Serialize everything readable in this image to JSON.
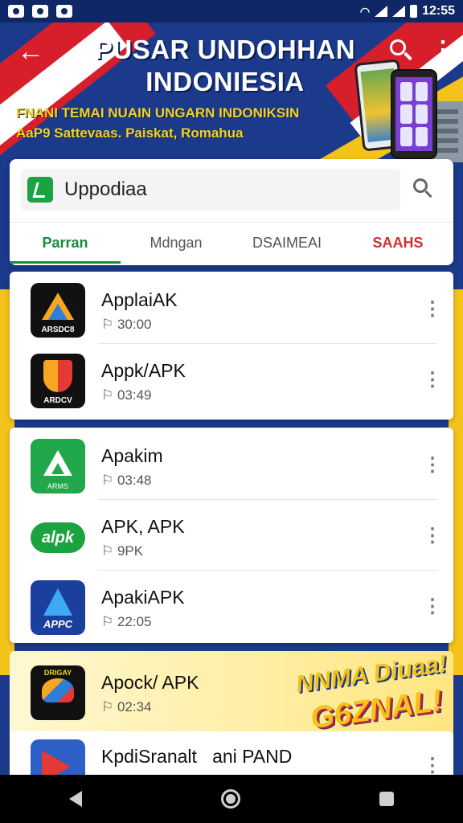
{
  "status_bar": {
    "time": "12:55"
  },
  "header": {
    "title": "PUSAR UNDOHHAN INDONIESIA",
    "subtitle_line1": "FNANI TEMAI NUAIN UNGARN INDONIKSIN",
    "subtitle_line2": "AaP9 Sattevaas. Paiskat, Romahua"
  },
  "search": {
    "value": "Uppodiaa",
    "placeholder": ""
  },
  "tabs": [
    {
      "label": "Parran"
    },
    {
      "label": "Mdngan"
    },
    {
      "label": "DSAIMEAI"
    },
    {
      "label": "SAAHS"
    }
  ],
  "apps": [
    {
      "name": "ApplaiAK",
      "meta": "30:00",
      "icon_label": "ARSDC8",
      "icon": "orange-triangle-icon"
    },
    {
      "name": "Appk/APK",
      "meta": "03:49",
      "icon_label": "ARDCV",
      "icon": "shield-icon"
    },
    {
      "name": "Apakim",
      "meta": "03:48",
      "icon_label": "ARMS",
      "icon": "green-a-icon"
    },
    {
      "name": "APK, APK",
      "meta": "9PK",
      "icon_label": "alpk",
      "icon": "green-pill-icon"
    },
    {
      "name": "ApakiAPK",
      "meta": "22:05",
      "icon_label": "APPC",
      "icon": "blue-a-icon"
    },
    {
      "name": "Apock/ APK",
      "meta": "02:34",
      "icon_label": "DRIGAY",
      "icon": "scooter-icon"
    },
    {
      "name": "KpdiSranalt",
      "name_suffix": "ani PAND",
      "meta": "",
      "icon": "red-arrow-icon"
    }
  ],
  "promo": {
    "line1": "NNMA Diuaa!",
    "line2": "G6ZNAL!"
  },
  "colors": {
    "primary_blue": "#1b3a8c",
    "accent_red": "#d61f2a",
    "accent_yellow": "#f3c21b",
    "tab_active_green": "#1b8a3a",
    "tab_alert_red": "#d32f2f"
  }
}
